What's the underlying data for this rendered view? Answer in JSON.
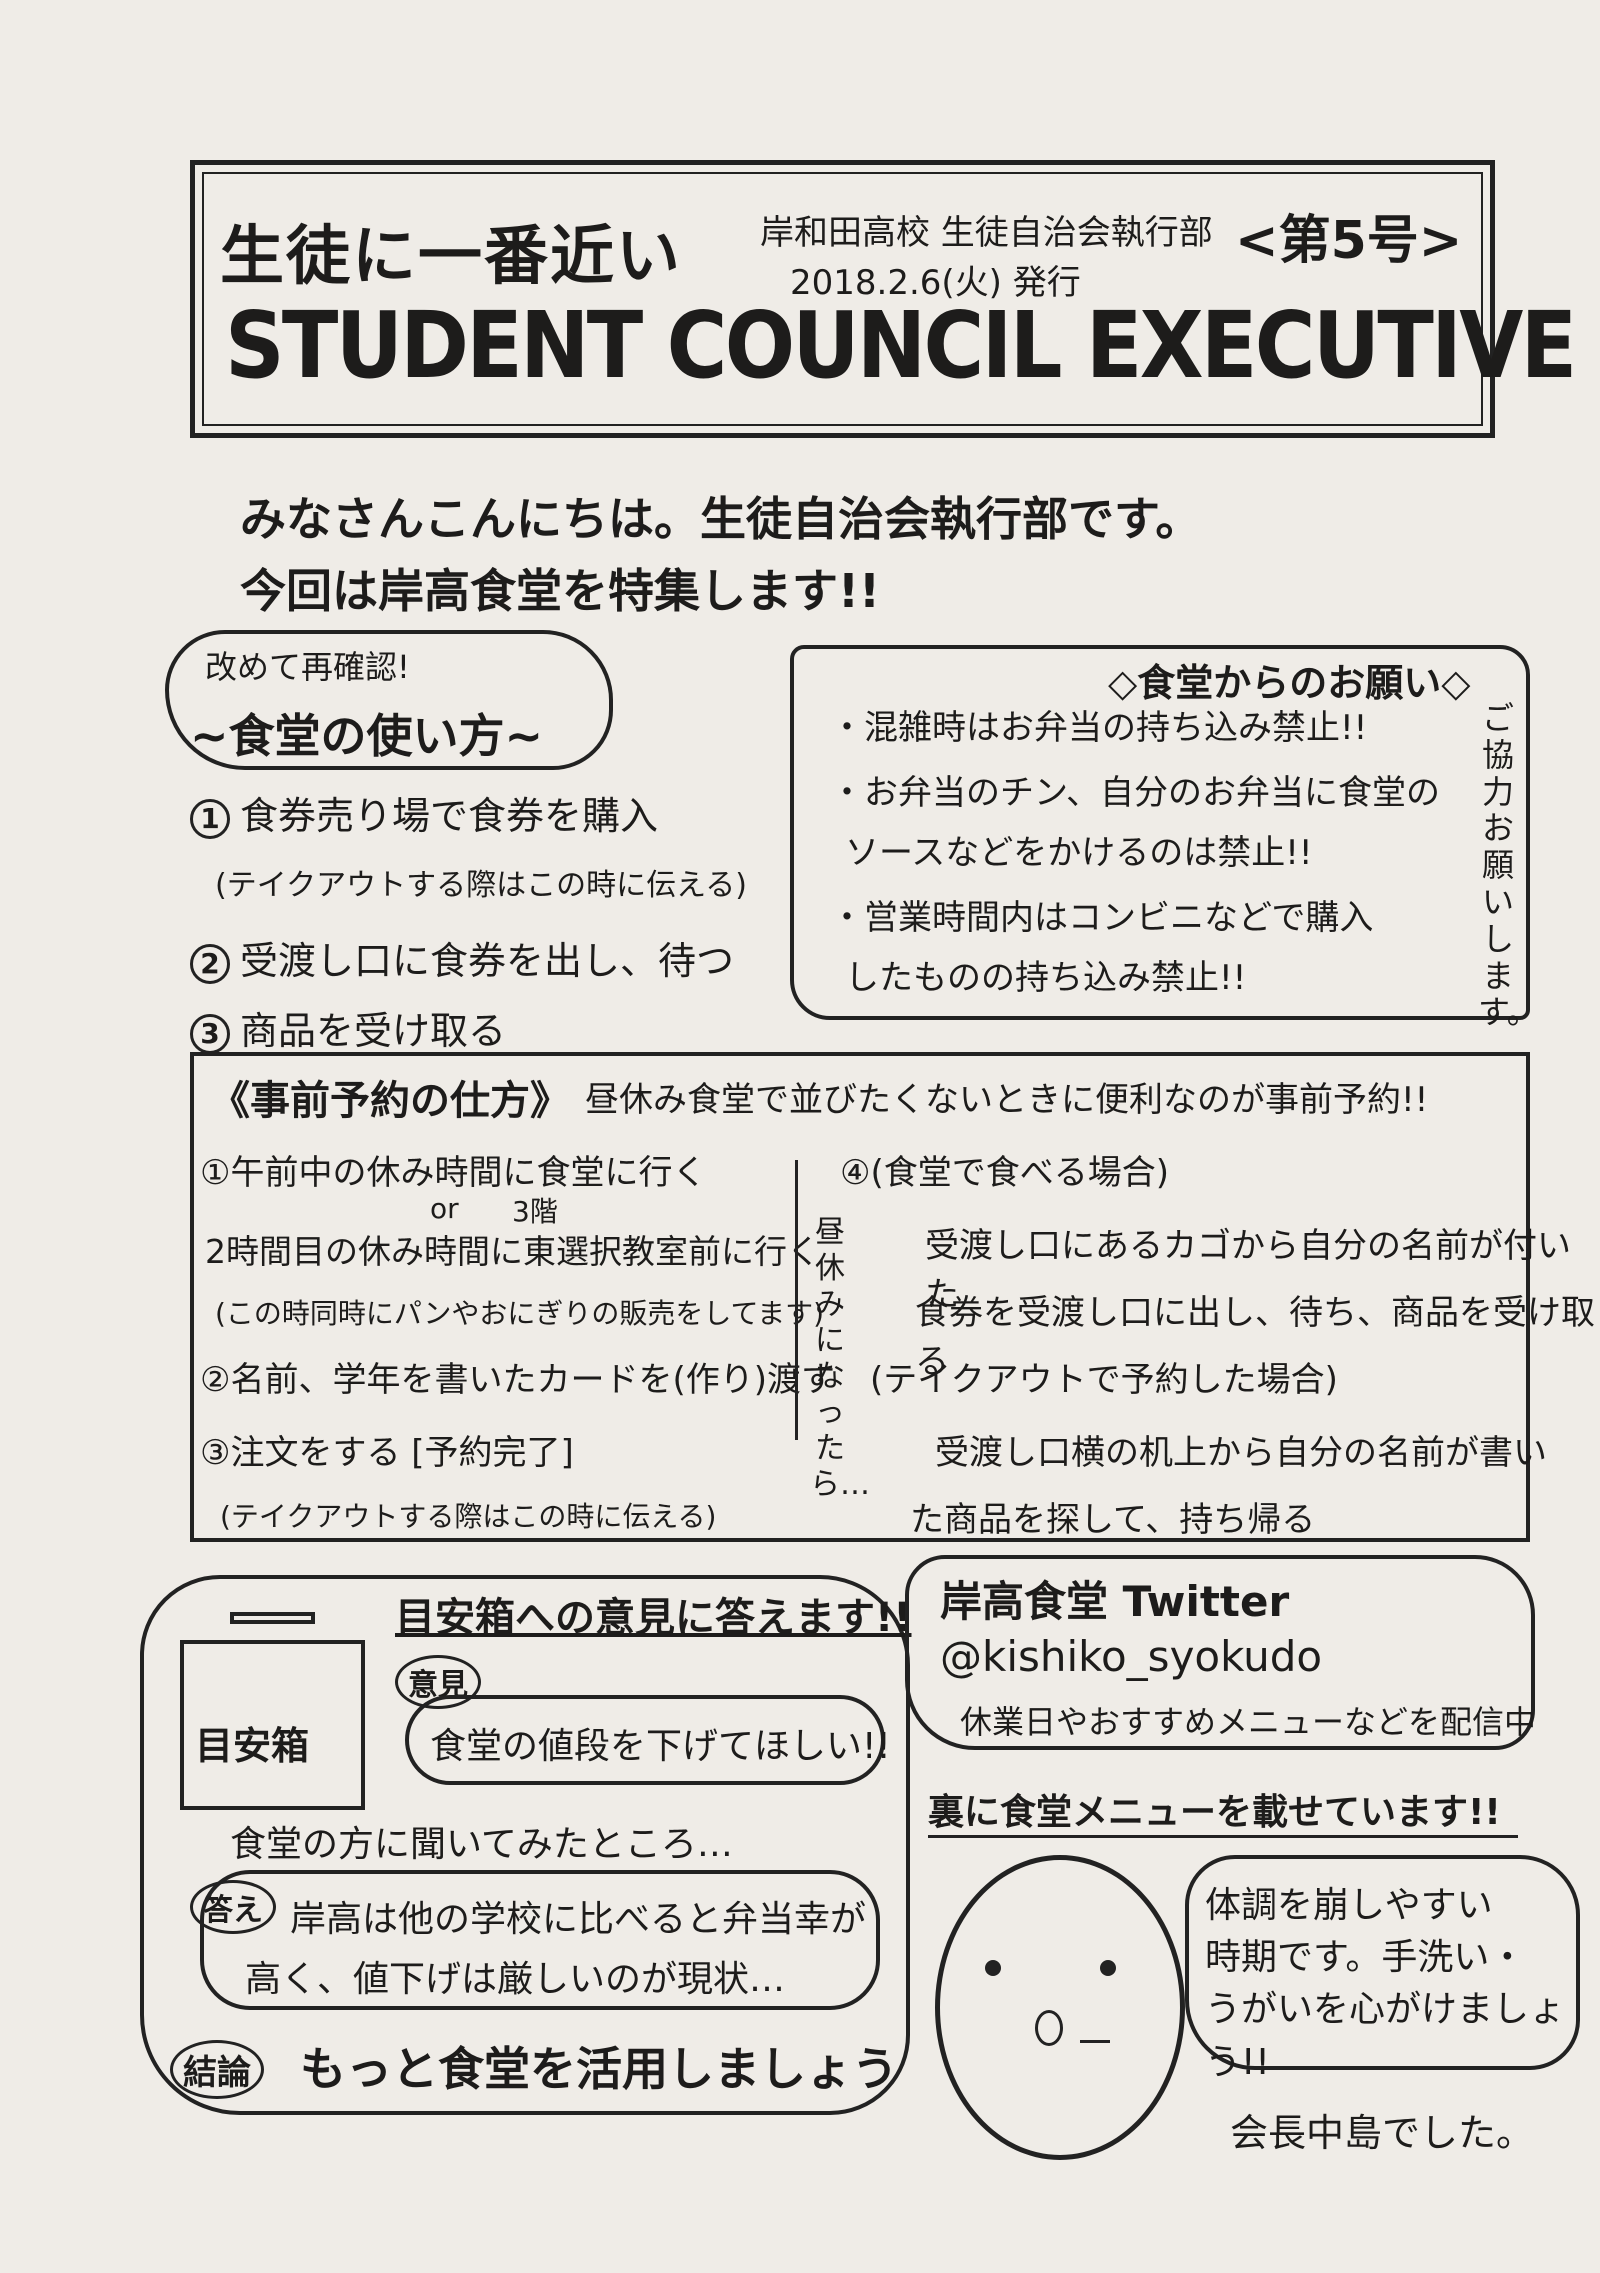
{
  "header": {
    "tagline": "生徒に一番近い",
    "school": "岸和田高校 生徒自治会執行部",
    "date": "2018.2.6(火) 発行",
    "issue": "<第5号>",
    "title": "STUDENT COUNCIL EXECUTIVE"
  },
  "intro": {
    "line1": "みなさんこんにちは。生徒自治会執行部です。",
    "line2": "今回は岸高食堂を特集します!!"
  },
  "howto": {
    "sub": "改めて再確認!",
    "title": "~食堂の使い方~",
    "steps": [
      {
        "num": "1",
        "text": "食券売り場で食券を購入"
      },
      {
        "num": "2",
        "text": "受渡し口に食券を出し、待つ"
      },
      {
        "num": "3",
        "text": "商品を受け取る"
      }
    ],
    "note": "(テイクアウトする際はこの時に伝える)"
  },
  "requests": {
    "title": "◇食堂からのお願い◇",
    "items": [
      "・混雑時はお弁当の持ち込み禁止!!",
      "・お弁当のチン、自分のお弁当に食堂の",
      "ソースなどをかけるのは禁止!!",
      "・営業時間内はコンビニなどで購入",
      "したものの持ち込み禁止!!"
    ],
    "side": "ご協力お願いします。"
  },
  "reservation": {
    "title": "《事前予約の仕方》",
    "desc": "昼休み食堂で並びたくないときに便利なのが事前予約!!",
    "s1a": "①午前中の休み時間に食堂に行く",
    "or": "or",
    "floor": "3階",
    "s1b": "2時間目の休み時間に東選択教室前に行く",
    "s1note": "(この時同時にパンやおにぎりの販売をしてます)",
    "s2": "②名前、学年を書いたカードを(作り)渡す",
    "s3": "③注文をする [予約完了]",
    "s3note": "(テイクアウトする際はこの時に伝える)",
    "vertical": "昼休みになったら…",
    "s4": "④(食堂で食べる場合)",
    "s4a": "受渡し口にあるカゴから自分の名前が付いた",
    "s4b": "食券を受渡し口に出し、待ち、商品を受け取る",
    "s4c": "(テイクアウトで予約した場合)",
    "s4d": "受渡し口横の机上から自分の名前が書い",
    "s4e": "た商品を探して、持ち帰る"
  },
  "suggestion": {
    "box_label": "目安箱",
    "title": "目安箱への意見に答えます!!",
    "opinion_tag": "意見",
    "opinion": "食堂の値段を下げてほしい!!",
    "asked": "食堂の方に聞いてみたところ…",
    "answer_tag": "答え",
    "answer1": "岸高は他の学校に比べると弁当幸が",
    "answer2": "高く、値下げは厳しいのが現状…",
    "conclusion_tag": "結論",
    "conclusion": "もっと食堂を活用しましょう"
  },
  "twitter": {
    "line1": "岸高食堂 Twitter",
    "handle": "@kishiko_syokudo",
    "line3": "休業日やおすすめメニューなどを配信中"
  },
  "back_menu": "裏に食堂メニューを載せています!!",
  "message": {
    "l1": "体調を崩しやすい",
    "l2": "時期です。手洗い・",
    "l3": "うがいを心がけましょう!!"
  },
  "signature": "会長中島でした。"
}
